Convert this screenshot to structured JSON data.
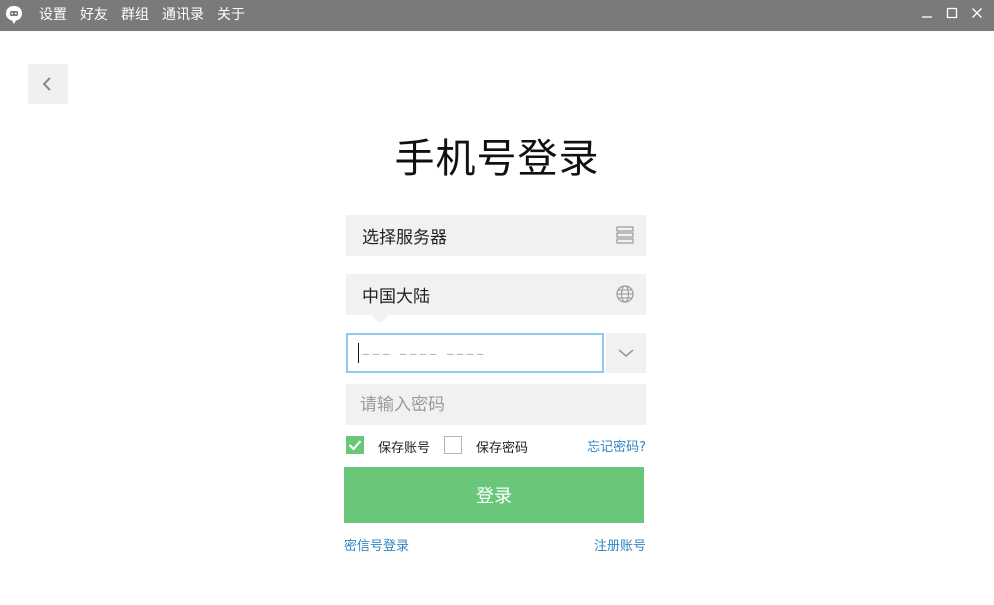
{
  "menu": {
    "items": [
      {
        "label": "设置"
      },
      {
        "label": "好友"
      },
      {
        "label": "群组"
      },
      {
        "label": "通讯录"
      },
      {
        "label": "关于"
      }
    ]
  },
  "window_controls": {
    "minimize": "minimize-icon",
    "maximize": "maximize-icon",
    "close": "close-icon"
  },
  "page": {
    "title": "手机号登录"
  },
  "form": {
    "server_label": "选择服务器",
    "region_label": "中国大陆",
    "phone_placeholder": "––– –––– ––––",
    "phone_value": "",
    "password_placeholder": "请输入密码",
    "password_value": "",
    "save_account_label": "保存账号",
    "save_account_checked": true,
    "save_password_label": "保存密码",
    "save_password_checked": false,
    "forgot_label": "忘记密码?",
    "login_label": "登录"
  },
  "links": {
    "mixin_login": "密信号登录",
    "register": "注册账号"
  },
  "colors": {
    "titlebar": "#7a7a7a",
    "accent_green": "#6ac77a",
    "link_blue": "#2f86c3",
    "field_bg": "#f1f1f1",
    "focus_border": "#8fcdf0"
  }
}
